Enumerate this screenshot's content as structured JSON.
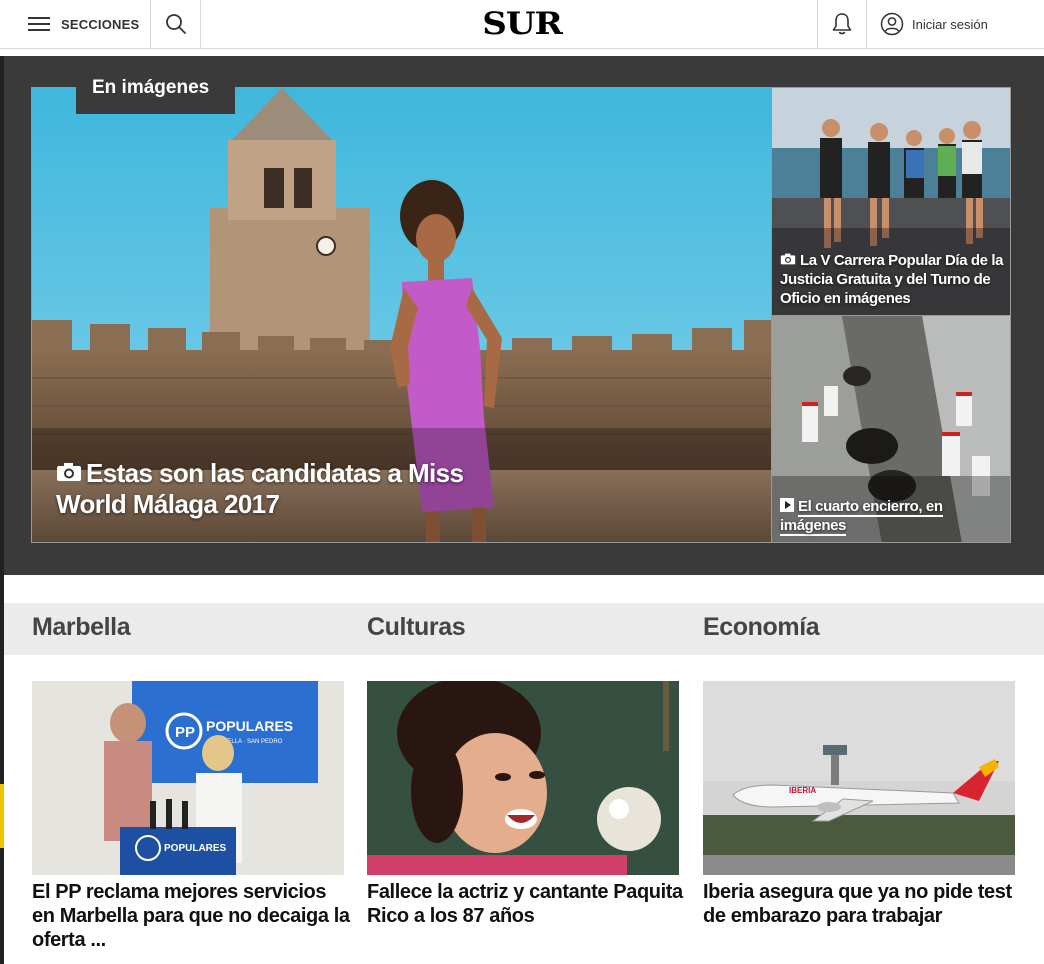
{
  "header": {
    "menu_label": "SECCIONES",
    "logo": "SUR",
    "login_label": "Iniciar sesión"
  },
  "gallery": {
    "label": "En imágenes",
    "main": {
      "title": "Estas son las candidatas a Miss World Málaga 2017"
    },
    "side": [
      {
        "title": "La V Carrera Popular Día de la Justicia Gratuita y del Turno de Oficio en imágenes"
      },
      {
        "title": "El cuarto encierro, en imágenes"
      }
    ]
  },
  "sections": [
    {
      "name": "Marbella",
      "headline": "El PP reclama mejores servicios en Marbella para que no decaiga la oferta ...",
      "sign_text": "POPULARES",
      "sign_sub": "MARBELLA · SAN PEDRO"
    },
    {
      "name": "Culturas",
      "headline": "Fallece la actriz y cantante Paquita Rico a los 87 años"
    },
    {
      "name": "Economía",
      "headline": "Iberia asegura que ya no pide test de embarazo para trabajar",
      "plane_text": "IBERIA"
    }
  ],
  "colors": {
    "gallery_bg": "#3a3a3a",
    "section_bar": "#ebebeb",
    "header_border": "#d9d9d9"
  }
}
